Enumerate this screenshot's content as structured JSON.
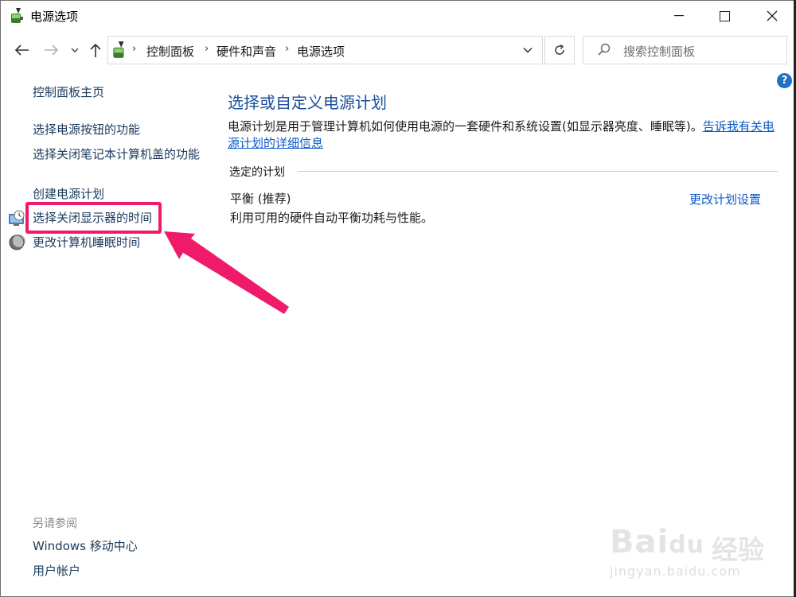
{
  "window": {
    "title": "电源选项"
  },
  "address": {
    "crumbs": [
      "控制面板",
      "硬件和声音",
      "电源选项"
    ],
    "search_placeholder": "搜索控制面板"
  },
  "left_nav": {
    "home": "控制面板主页",
    "items": [
      {
        "label": "选择电源按钮的功能"
      },
      {
        "label": "选择关闭笔记本计算机盖的功能"
      },
      {
        "label": "创建电源计划"
      },
      {
        "label": "选择关闭显示器的时间",
        "icon": "display-clock-icon",
        "highlighted": true
      },
      {
        "label": "更改计算机睡眠时间",
        "icon": "moon-icon"
      }
    ],
    "see_also_title": "另请参阅",
    "see_also": [
      "Windows 移动中心",
      "用户帐户"
    ]
  },
  "main": {
    "title": "选择或自定义电源计划",
    "description": "电源计划是用于管理计算机如何使用电源的一套硬件和系统设置(如显示器亮度、睡眠等)。",
    "more_link": "告诉我有关电源计划的详细信息",
    "group_label": "选定的计划",
    "plan_name": "平衡 (推荐)",
    "plan_description": "利用可用的硬件自动平衡功耗与性能。",
    "plan_settings_link": "更改计划设置"
  },
  "watermark": {
    "brand": "Bai",
    "brand_suffix": "du",
    "brand_cn": "经验",
    "url": "jingyan.baidu.com"
  },
  "colors": {
    "link": "#1a3a5c",
    "title": "#1b4f9c",
    "highlight": "#ef1a6a",
    "help": "#1e70c9"
  }
}
